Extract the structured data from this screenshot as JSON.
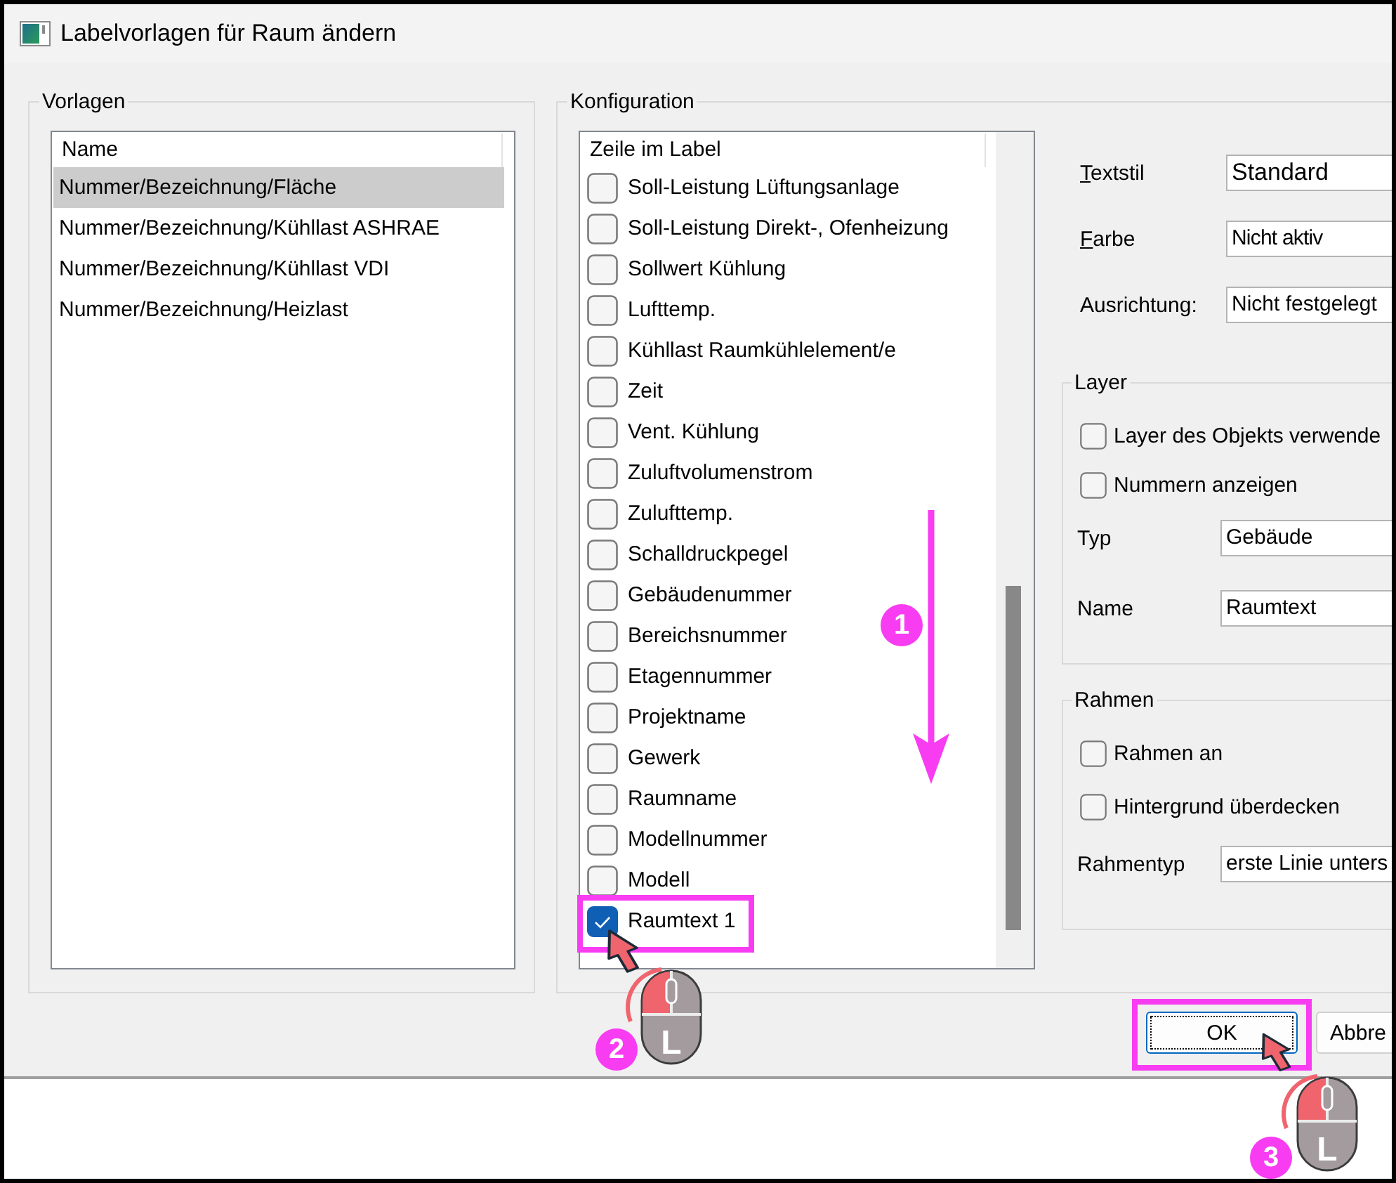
{
  "window": {
    "title": "Labelvorlagen für Raum ändern"
  },
  "templates": {
    "legend": "Vorlagen",
    "column": "Name",
    "items": [
      {
        "label": "Nummer/Bezeichnung/Fläche",
        "selected": true
      },
      {
        "label": "Nummer/Bezeichnung/Kühllast ASHRAE",
        "selected": false
      },
      {
        "label": "Nummer/Bezeichnung/Kühllast VDI",
        "selected": false
      },
      {
        "label": "Nummer/Bezeichnung/Heizlast",
        "selected": false
      }
    ]
  },
  "configuration": {
    "legend": "Konfiguration",
    "column": "Zeile im Label",
    "items": [
      {
        "label": "Soll-Leistung Lüftungsanlage",
        "checked": false,
        "highlighted": false
      },
      {
        "label": "Soll-Leistung Direkt-, Ofenheizung",
        "checked": false,
        "highlighted": false
      },
      {
        "label": "Sollwert Kühlung",
        "checked": false,
        "highlighted": false
      },
      {
        "label": "Lufttemp.",
        "checked": false,
        "highlighted": false
      },
      {
        "label": "Kühllast Raumkühlelement/e",
        "checked": false,
        "highlighted": false
      },
      {
        "label": "Zeit",
        "checked": false,
        "highlighted": false
      },
      {
        "label": "Vent. Kühlung",
        "checked": false,
        "highlighted": false
      },
      {
        "label": "Zuluftvolumenstrom",
        "checked": false,
        "highlighted": false
      },
      {
        "label": "Zulufttemp.",
        "checked": false,
        "highlighted": false
      },
      {
        "label": "Schalldruckpegel",
        "checked": false,
        "highlighted": false
      },
      {
        "label": "Gebäudenummer",
        "checked": false,
        "highlighted": false
      },
      {
        "label": "Bereichsnummer",
        "checked": false,
        "highlighted": false
      },
      {
        "label": "Etagennummer",
        "checked": false,
        "highlighted": false
      },
      {
        "label": "Projektname",
        "checked": false,
        "highlighted": false
      },
      {
        "label": "Gewerk",
        "checked": false,
        "highlighted": false
      },
      {
        "label": "Raumname",
        "checked": false,
        "highlighted": false
      },
      {
        "label": "Modellnummer",
        "checked": false,
        "highlighted": false
      },
      {
        "label": "Modell",
        "checked": false,
        "highlighted": false
      },
      {
        "label": "Raumtext 1",
        "checked": true,
        "highlighted": true
      }
    ],
    "text_fields": [
      {
        "label": "Textstil",
        "value": "Standard",
        "mnemonic": true
      },
      {
        "label": "Farbe",
        "value": "Nicht aktiv",
        "mnemonic": true
      },
      {
        "label": "Ausrichtung:",
        "value": "Nicht festgelegt",
        "mnemonic": false
      }
    ],
    "layer": {
      "legend": "Layer",
      "options": [
        {
          "label": "Layer des Objekts verwende",
          "checked": false
        },
        {
          "label": "Nummern anzeigen",
          "checked": false
        }
      ],
      "fields": [
        {
          "label": "Typ",
          "value": "Gebäude"
        },
        {
          "label": "Name",
          "value": "Raumtext"
        }
      ]
    },
    "frame": {
      "legend": "Rahmen",
      "options": [
        {
          "label": "Rahmen an",
          "checked": false
        },
        {
          "label": "Hintergrund überdecken",
          "checked": false
        }
      ],
      "fields": [
        {
          "label": "Rahmentyp",
          "value": "erste Linie unters"
        }
      ]
    }
  },
  "buttons": [
    {
      "label": "OK",
      "focused": true,
      "highlighted": true
    },
    {
      "label": "Abbre",
      "focused": false,
      "highlighted": false
    }
  ],
  "annotations": [
    {
      "kind": "arrow",
      "badge": "1"
    },
    {
      "kind": "click",
      "badge": "2",
      "mouse_button": "L"
    },
    {
      "kind": "click",
      "badge": "3",
      "mouse_button": "L"
    }
  ]
}
